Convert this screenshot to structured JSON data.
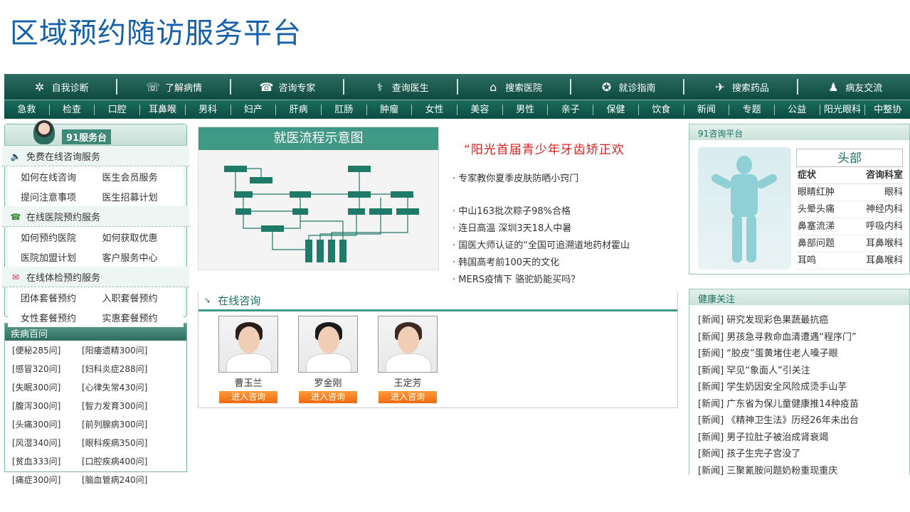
{
  "slide_title": "区域预约随访服务平台",
  "nav_main": [
    {
      "label": "自我诊断",
      "icon": "plant-icon"
    },
    {
      "label": "了解病情",
      "icon": "phone-icon"
    },
    {
      "label": "咨询专家",
      "icon": "consult-icon"
    },
    {
      "label": "查询医生",
      "icon": "doctor-icon"
    },
    {
      "label": "搜索医院",
      "icon": "hospital-icon"
    },
    {
      "label": "就诊指南",
      "icon": "guide-icon"
    },
    {
      "label": "搜索药品",
      "icon": "plane-icon"
    },
    {
      "label": "病友交流",
      "icon": "people-icon"
    }
  ],
  "nav_sub": [
    "急救",
    "检查",
    "口腔",
    "耳鼻喉",
    "男科",
    "妇产",
    "肝病",
    "肛肠",
    "肿瘤",
    "女性",
    "美容",
    "男性",
    "亲子",
    "保健",
    "饮食",
    "新闻",
    "专题",
    "公益",
    "阳光眼科",
    "中整协"
  ],
  "service": {
    "title": "91服务台",
    "sections": [
      {
        "title": "免费在线咨询服务",
        "icon": "speaker-icon",
        "rows": [
          [
            "如何在线咨询",
            "医生会员服务"
          ],
          [
            "提问注意事项",
            "医生招募计划"
          ]
        ]
      },
      {
        "title": "在线医院预约服务",
        "icon": "telephone-icon",
        "rows": [
          [
            "如何预约医院",
            "如何获取优惠"
          ],
          [
            "医院加盟计划",
            "客户服务中心"
          ]
        ]
      },
      {
        "title": "在线体检预约服务",
        "icon": "checkup-icon",
        "rows": [
          [
            "团体套餐预约",
            "入职套餐预约"
          ],
          [
            "女性套餐预约",
            "实惠套餐预约"
          ]
        ]
      }
    ]
  },
  "disease": {
    "title": "疾病百问",
    "rows": [
      [
        "[便秘285问]",
        "[阳痿遗精300问]"
      ],
      [
        "[感冒320问]",
        "[妇科炎症288问]"
      ],
      [
        "[失眠300问]",
        "[心律失常430问]"
      ],
      [
        "[腹泻300问]",
        "[智力发育300问]"
      ],
      [
        "[头痛300问]",
        "[前列腺病300问]"
      ],
      [
        "[风湿340问]",
        "[眼科疾病350问]"
      ],
      [
        "[贫血333问]",
        "[口腔疾病400问]"
      ],
      [
        "[痛症300问]",
        "[脑血管病240问]"
      ]
    ]
  },
  "flow": {
    "title": "就医流程示意图"
  },
  "headline": "“阳光首届青少年牙齿矫正欢",
  "news_top": "· 专家教你夏季皮肤防晒小窍门",
  "news": [
    "· 中山163批次粽子98%合格",
    "· 连日高温  深圳3天18人中暑",
    "· 国医大师认证的“全国可追溯道地药材霍山",
    "· 韩国高考前100天的文化",
    "· MERS疫情下  骆驼奶能买吗？"
  ],
  "consult": {
    "title": "在线咨询",
    "button_label": "进入咨询",
    "doctors": [
      {
        "name": "曹玉兰",
        "hair": "#2a1e18"
      },
      {
        "name": "罗金刚",
        "hair": "#1b1b1b"
      },
      {
        "name": "王定芳",
        "hair": "#3a2a20"
      }
    ]
  },
  "platform": {
    "title": "91咨询平台",
    "part": "头部",
    "headers": [
      "症状",
      "咨询科室"
    ],
    "rows": [
      [
        "眼睛红肿",
        "眼科"
      ],
      [
        "头晕头痛",
        "神经内科"
      ],
      [
        "鼻塞流涕",
        "呼吸内科"
      ],
      [
        "鼻部问题",
        "耳鼻喉科"
      ],
      [
        "耳鸣",
        "耳鼻喉科"
      ]
    ]
  },
  "health": {
    "title": "健康关注",
    "items": [
      "[新闻] 研究发现彩色果蔬最抗癌",
      "[新闻] 男孩急寻救命血清遭遇“程序门”",
      "[新闻] “胶皮”蛋黄堵住老人嗓子眼",
      "[新闻] 罕见“象面人”引关注",
      "[新闻] 学生奶因安全风险成烫手山芋",
      "[新闻] 广东省为保儿童健康推14种疫苗",
      "[新闻] 《精神卫生法》历经26年未出台",
      "[新闻] 男子拉肚子被治成肾衰竭",
      "[新闻] 孩子生完子宫没了",
      "[新闻] 三聚氰胺问题奶粉重现重庆"
    ]
  }
}
